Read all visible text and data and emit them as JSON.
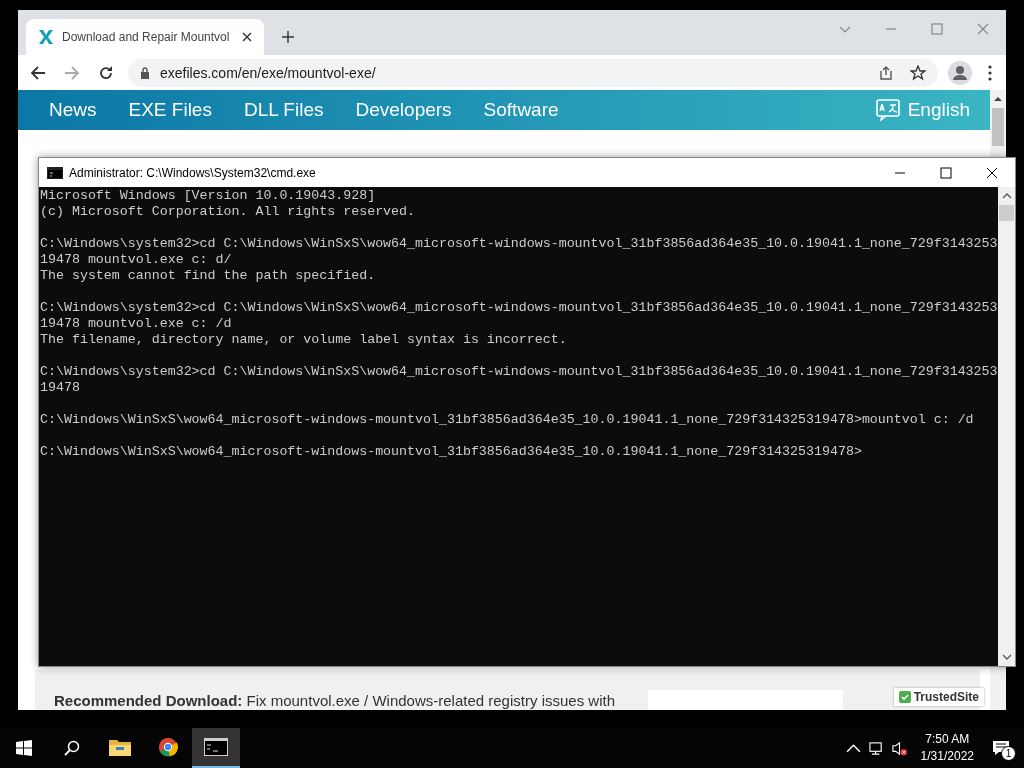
{
  "browser": {
    "tab": {
      "title": "Download and Repair Mountvol",
      "selected": true
    },
    "address": "exefiles.com/en/exe/mountvol-exe/",
    "nav": [
      {
        "label": "News"
      },
      {
        "label": "EXE Files"
      },
      {
        "label": "DLL Files"
      },
      {
        "label": "Developers"
      },
      {
        "label": "Software"
      }
    ],
    "language": "English",
    "recommended": {
      "lead": "Recommended Download:",
      "text": "Fix mountvol.exe / Windows-related registry issues with"
    },
    "trust_badge": "TrustedSite"
  },
  "console": {
    "title": "Administrator: C:\\Windows\\System32\\cmd.exe",
    "blocks": [
      [
        "Microsoft Windows [Version 10.0.19043.928]",
        "(c) Microsoft Corporation. All rights reserved."
      ],
      [
        "C:\\Windows\\system32>cd C:\\Windows\\WinSxS\\wow64_microsoft-windows-mountvol_31bf3856ad364e35_10.0.19041.1_none_729f3143253",
        "19478 mountvol.exe c: d/",
        "The system cannot find the path specified."
      ],
      [
        "C:\\Windows\\system32>cd C:\\Windows\\WinSxS\\wow64_microsoft-windows-mountvol_31bf3856ad364e35_10.0.19041.1_none_729f3143253",
        "19478 mountvol.exe c: /d",
        "The filename, directory name, or volume label syntax is incorrect."
      ],
      [
        "C:\\Windows\\system32>cd C:\\Windows\\WinSxS\\wow64_microsoft-windows-mountvol_31bf3856ad364e35_10.0.19041.1_none_729f3143253",
        "19478"
      ],
      [
        "C:\\Windows\\WinSxS\\wow64_microsoft-windows-mountvol_31bf3856ad364e35_10.0.19041.1_none_729f314325319478>mountvol c: /d"
      ],
      [
        "C:\\Windows\\WinSxS\\wow64_microsoft-windows-mountvol_31bf3856ad364e35_10.0.19041.1_none_729f314325319478>"
      ]
    ]
  },
  "taskbar": {
    "apps": [
      {
        "kind": "folder",
        "selected": false
      },
      {
        "kind": "chrome",
        "selected": false
      },
      {
        "kind": "console",
        "selected": true
      }
    ],
    "time": "7:50 AM",
    "date": "1/31/2022",
    "notifications": "1"
  }
}
